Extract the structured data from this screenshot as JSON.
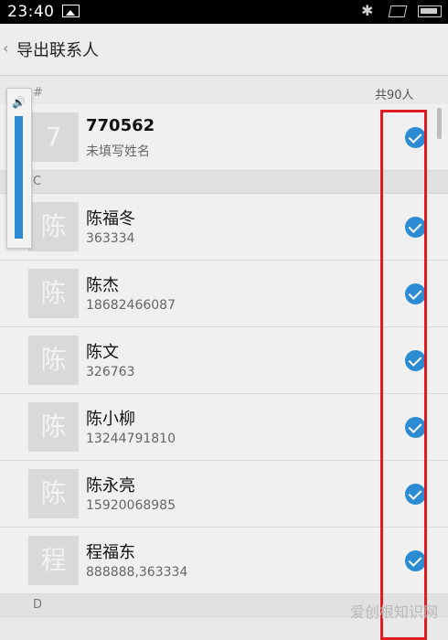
{
  "status_bar": {
    "time": "23:40"
  },
  "header": {
    "title": "导出联系人"
  },
  "list_header": {
    "index": "#",
    "total": "共90人"
  },
  "sections": [
    {
      "letter": "",
      "contacts": [
        {
          "avatar": "7",
          "name": "770562",
          "sub": "未填写姓名",
          "checked": true
        }
      ]
    },
    {
      "letter": "C",
      "contacts": [
        {
          "avatar": "陈",
          "name": "陈福冬",
          "sub": "363334",
          "checked": true
        },
        {
          "avatar": "陈",
          "name": "陈杰",
          "sub": "18682466087",
          "checked": true
        },
        {
          "avatar": "陈",
          "name": "陈文",
          "sub": "326763",
          "checked": true
        },
        {
          "avatar": "陈",
          "name": "陈小柳",
          "sub": "13244791810",
          "checked": true
        },
        {
          "avatar": "陈",
          "name": "陈永亮",
          "sub": "15920068985",
          "checked": true
        },
        {
          "avatar": "程",
          "name": "程福东",
          "sub": "888888,363334",
          "checked": true
        }
      ]
    },
    {
      "letter": "D",
      "contacts": []
    }
  ],
  "volume": {
    "level": 1.0
  },
  "watermark": "爱创根知识网",
  "colors": {
    "accent": "#2b8bd3",
    "highlight": "#e11b22"
  }
}
